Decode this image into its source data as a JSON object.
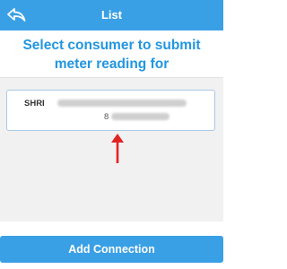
{
  "topbar": {
    "title": "List"
  },
  "heading": {
    "line1": "Select consumer to submit",
    "line2": "meter reading for"
  },
  "consumers": [
    {
      "name_prefix": "SHRI",
      "number_prefix": "8"
    }
  ],
  "actions": {
    "add_connection_label": "Add Connection"
  },
  "colors": {
    "brand": "#3aa0e6",
    "heading": "#2296e0",
    "annotation": "#e02424"
  },
  "icons": {
    "back": "back-arrow-icon",
    "annotation": "up-arrow-icon"
  }
}
